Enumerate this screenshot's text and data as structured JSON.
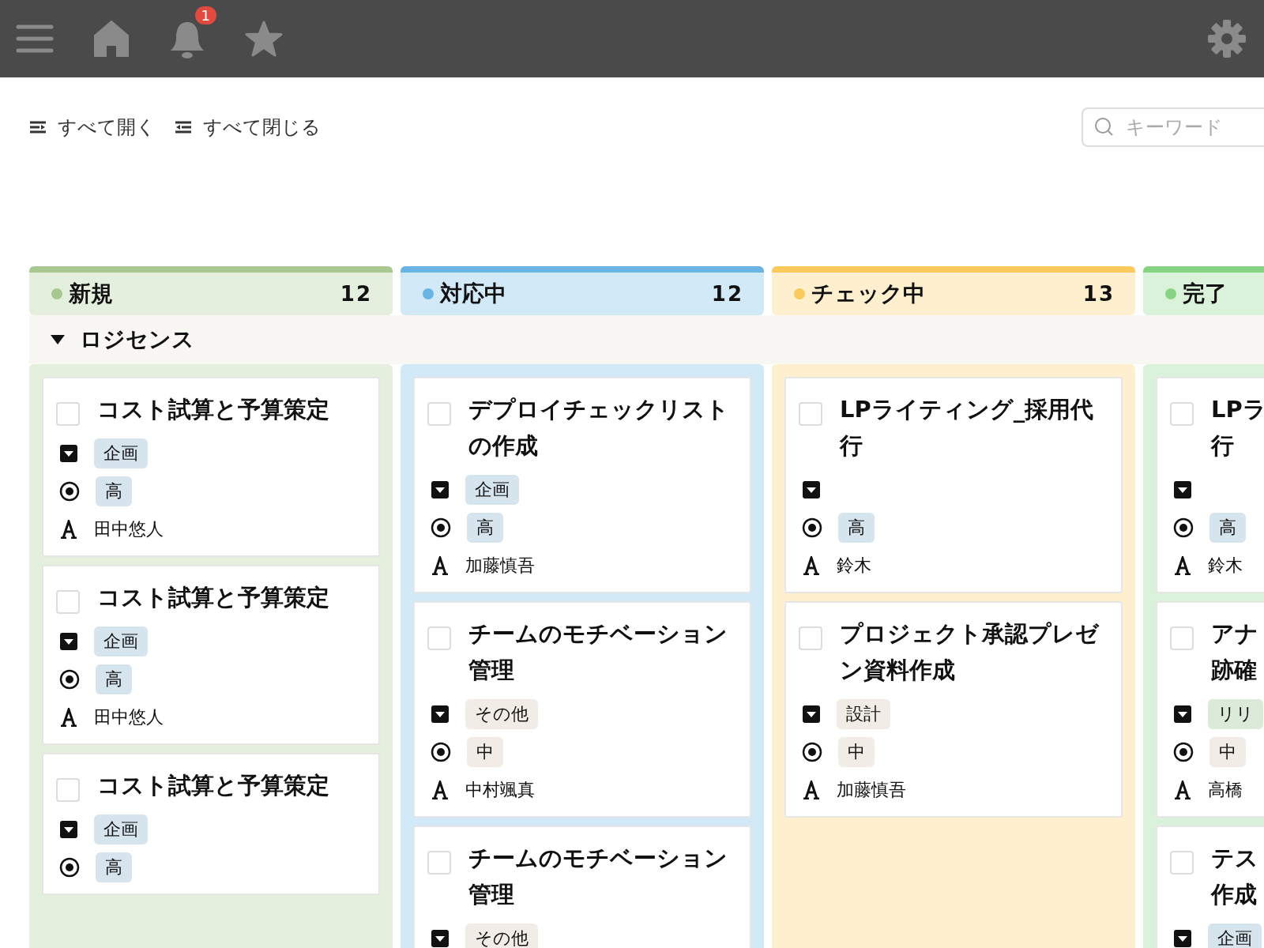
{
  "topbar": {
    "notification_count": "1"
  },
  "toolbar": {
    "expand_all": "すべて開く",
    "collapse_all": "すべて閉じる",
    "search": {
      "placeholder": "キーワード"
    }
  },
  "group": {
    "name": "ロジセンス",
    "expanded": true
  },
  "columns": [
    {
      "name": "新規",
      "count": "12",
      "color": "#a8c88f",
      "cards": [
        {
          "title_lines": [
            "コスト試算と予算策定"
          ],
          "checked": false,
          "category": {
            "label": "企画",
            "color": "#d6e4ee"
          },
          "priority": {
            "label": "高",
            "color": "#d6e4ee"
          },
          "assignee": "田中悠人"
        },
        {
          "title_lines": [
            "コスト試算と予算策定"
          ],
          "checked": false,
          "category": {
            "label": "企画",
            "color": "#d6e4ee"
          },
          "priority": {
            "label": "高",
            "color": "#d6e4ee"
          },
          "assignee": "田中悠人"
        },
        {
          "title_lines": [
            "コスト試算と予算策定"
          ],
          "checked": false,
          "category": {
            "label": "企画",
            "color": "#d6e4ee"
          },
          "priority": {
            "label": "高",
            "color": "#d6e4ee"
          }
        }
      ]
    },
    {
      "name": "対応中",
      "count": "12",
      "color": "#6ab4e4",
      "cards": [
        {
          "title_lines": [
            "デプロイチェックリスト",
            "の作成"
          ],
          "checked": false,
          "category": {
            "label": "企画",
            "color": "#d6e4ee"
          },
          "priority": {
            "label": "高",
            "color": "#d6e4ee"
          },
          "assignee": "加藤慎吾"
        },
        {
          "title_lines": [
            "チームのモチベーション",
            "管理"
          ],
          "checked": false,
          "category": {
            "label": "その他",
            "color": "#f1ede6"
          },
          "priority": {
            "label": "中",
            "color": "#f1ede6"
          },
          "assignee": "中村颯真"
        },
        {
          "title_lines": [
            "チームのモチベーション",
            "管理"
          ],
          "checked": false,
          "category": {
            "label": "その他",
            "color": "#f1ede6"
          }
        }
      ]
    },
    {
      "name": "チェック中",
      "count": "13",
      "color": "#fbc95c",
      "cards": [
        {
          "title_lines": [
            "LPライティング_採用代",
            "行"
          ],
          "checked": false,
          "priority": {
            "label": "高",
            "color": "#d6e4ee"
          },
          "assignee": "鈴木"
        },
        {
          "title_lines": [
            "プロジェクト承認プレゼ",
            "ン資料作成"
          ],
          "checked": false,
          "category": {
            "label": "設計",
            "color": "#f1ede6"
          },
          "priority": {
            "label": "中",
            "color": "#f1ede6"
          },
          "assignee": "加藤慎吾"
        }
      ]
    },
    {
      "name": "完了",
      "color": "#86d483",
      "cards": [
        {
          "title_lines": [
            "LPラ",
            "行"
          ],
          "checked": false,
          "priority": {
            "label": "高",
            "color": "#d6e4ee"
          },
          "assignee": "鈴木"
        },
        {
          "title_lines": [
            "アナ",
            "跡確"
          ],
          "checked": false,
          "category": {
            "label": "リリ",
            "color": "#dcebd9"
          },
          "priority": {
            "label": "中",
            "color": "#f1ede6"
          },
          "assignee": "高橋"
        },
        {
          "title_lines": [
            "テス",
            "作成"
          ],
          "checked": false,
          "category": {
            "label": "企画",
            "color": "#d6e4ee"
          }
        }
      ]
    }
  ]
}
